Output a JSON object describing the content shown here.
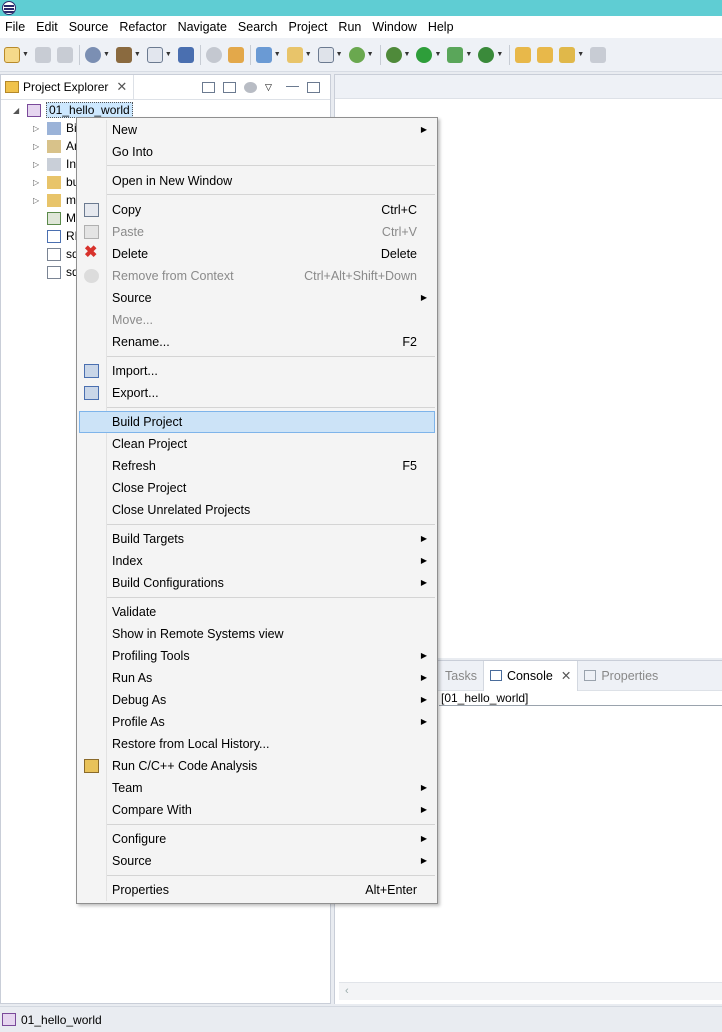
{
  "menubar": [
    "File",
    "Edit",
    "Source",
    "Refactor",
    "Navigate",
    "Search",
    "Project",
    "Run",
    "Window",
    "Help"
  ],
  "explorer": {
    "tab_label": "Project Explorer",
    "project": "01_hello_world",
    "children": [
      {
        "label": "Bi",
        "icon": "binaries-icon"
      },
      {
        "label": "Ar",
        "icon": "archives-icon"
      },
      {
        "label": "In",
        "icon": "includes-icon"
      },
      {
        "label": "bu",
        "icon": "folder-icon"
      },
      {
        "label": "m",
        "icon": "folder-icon"
      },
      {
        "label": "M",
        "icon": "makefile-icon"
      },
      {
        "label": "RE",
        "icon": "word-doc-icon"
      },
      {
        "label": "sd",
        "icon": "file-icon"
      },
      {
        "label": "sd",
        "icon": "file-icon"
      }
    ]
  },
  "context_menu": {
    "items": [
      {
        "label": "New",
        "submenu": true
      },
      {
        "label": "Go Into"
      },
      {
        "separator": true
      },
      {
        "label": "Open in New Window"
      },
      {
        "separator": true
      },
      {
        "label": "Copy",
        "shortcut": "Ctrl+C",
        "icon": "copy-icon"
      },
      {
        "label": "Paste",
        "shortcut": "Ctrl+V",
        "disabled": true,
        "icon": "paste-icon"
      },
      {
        "label": "Delete",
        "shortcut": "Delete",
        "icon": "delete-icon"
      },
      {
        "label": "Remove from Context",
        "shortcut": "Ctrl+Alt+Shift+Down",
        "disabled": true,
        "icon": "remove-context-icon"
      },
      {
        "label": "Source",
        "submenu": true
      },
      {
        "label": "Move...",
        "disabled": true
      },
      {
        "label": "Rename...",
        "shortcut": "F2"
      },
      {
        "separator": true
      },
      {
        "label": "Import...",
        "icon": "import-icon"
      },
      {
        "label": "Export...",
        "icon": "export-icon"
      },
      {
        "separator": true
      },
      {
        "label": "Build Project",
        "highlighted": true
      },
      {
        "label": "Clean Project"
      },
      {
        "label": "Refresh",
        "shortcut": "F5"
      },
      {
        "label": "Close Project"
      },
      {
        "label": "Close Unrelated Projects"
      },
      {
        "separator": true
      },
      {
        "label": "Build Targets",
        "submenu": true
      },
      {
        "label": "Index",
        "submenu": true
      },
      {
        "label": "Build Configurations",
        "submenu": true
      },
      {
        "separator": true
      },
      {
        "label": "Validate"
      },
      {
        "label": "Show in Remote Systems view"
      },
      {
        "label": "Profiling Tools",
        "submenu": true
      },
      {
        "label": "Run As",
        "submenu": true
      },
      {
        "label": "Debug As",
        "submenu": true
      },
      {
        "label": "Profile As",
        "submenu": true
      },
      {
        "label": "Restore from Local History..."
      },
      {
        "label": "Run C/C++ Code Analysis",
        "icon": "code-analysis-icon"
      },
      {
        "label": "Team",
        "submenu": true
      },
      {
        "label": "Compare With",
        "submenu": true
      },
      {
        "separator": true
      },
      {
        "label": "Configure",
        "submenu": true
      },
      {
        "label": "Source",
        "submenu": true
      },
      {
        "separator": true
      },
      {
        "label": "Properties",
        "shortcut": "Alt+Enter"
      }
    ]
  },
  "console": {
    "tabs": [
      "Tasks",
      "Console",
      "Properties"
    ],
    "active_tab": "Console",
    "line": "[01_hello_world]"
  },
  "status": {
    "text": "01_hello_world"
  },
  "colors": {
    "titlebar": "#5fcdd3",
    "highlight": "#cce3f7",
    "highlight_border": "#7eb4ea"
  }
}
